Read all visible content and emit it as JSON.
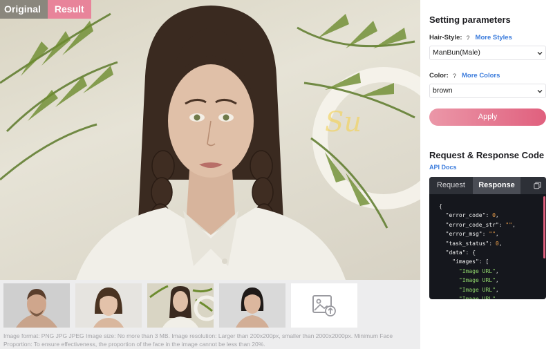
{
  "view_toggle": {
    "original": "Original",
    "result": "Result",
    "active": "result"
  },
  "thumbnails": [
    {
      "name": "thumb-man",
      "selected": false
    },
    {
      "name": "thumb-short-hair-woman",
      "selected": false
    },
    {
      "name": "thumb-braided-woman",
      "selected": true
    },
    {
      "name": "thumb-dark-hair-woman",
      "selected": false
    }
  ],
  "upload_icon": "image-upload-icon",
  "note": "Image format: PNG JPG JPEG Image size: No more than 3 MB. Image resolution: Larger than 200x200px, smaller than 2000x2000px. Minimum Face Proportion: To ensure effectiveness, the proportion of the face in the image cannot be less than 20%.",
  "settings": {
    "title": "Setting parameters",
    "hair_style": {
      "label": "Hair-Style:",
      "help": "?",
      "more": "More Styles",
      "value": "ManBun(Male)"
    },
    "color": {
      "label": "Color:",
      "help": "?",
      "more": "More Colors",
      "value": "brown"
    },
    "apply": "Apply"
  },
  "code_section": {
    "title": "Request & Response Code",
    "api_docs": "API Docs",
    "tabs": {
      "request": "Request",
      "response": "Response",
      "active": "response"
    },
    "lines": {
      "l1": "{",
      "l2_key": "\"error_code\"",
      "l2_val": "0",
      "l3_key": "\"error_code_str\"",
      "l3_val": "\"\"",
      "l4_key": "\"error_msg\"",
      "l4_val": "\"\"",
      "l5_key": "\"task_status\"",
      "l5_val": "0",
      "l6_key": "\"data\"",
      "l6_val": "{",
      "l7_key": "\"images\"",
      "l7_val": "[",
      "img": "\"Image URL\""
    }
  },
  "colors": {
    "accent": "#e0607e",
    "link": "#3a7bdc",
    "code_bg": "#15171d"
  }
}
